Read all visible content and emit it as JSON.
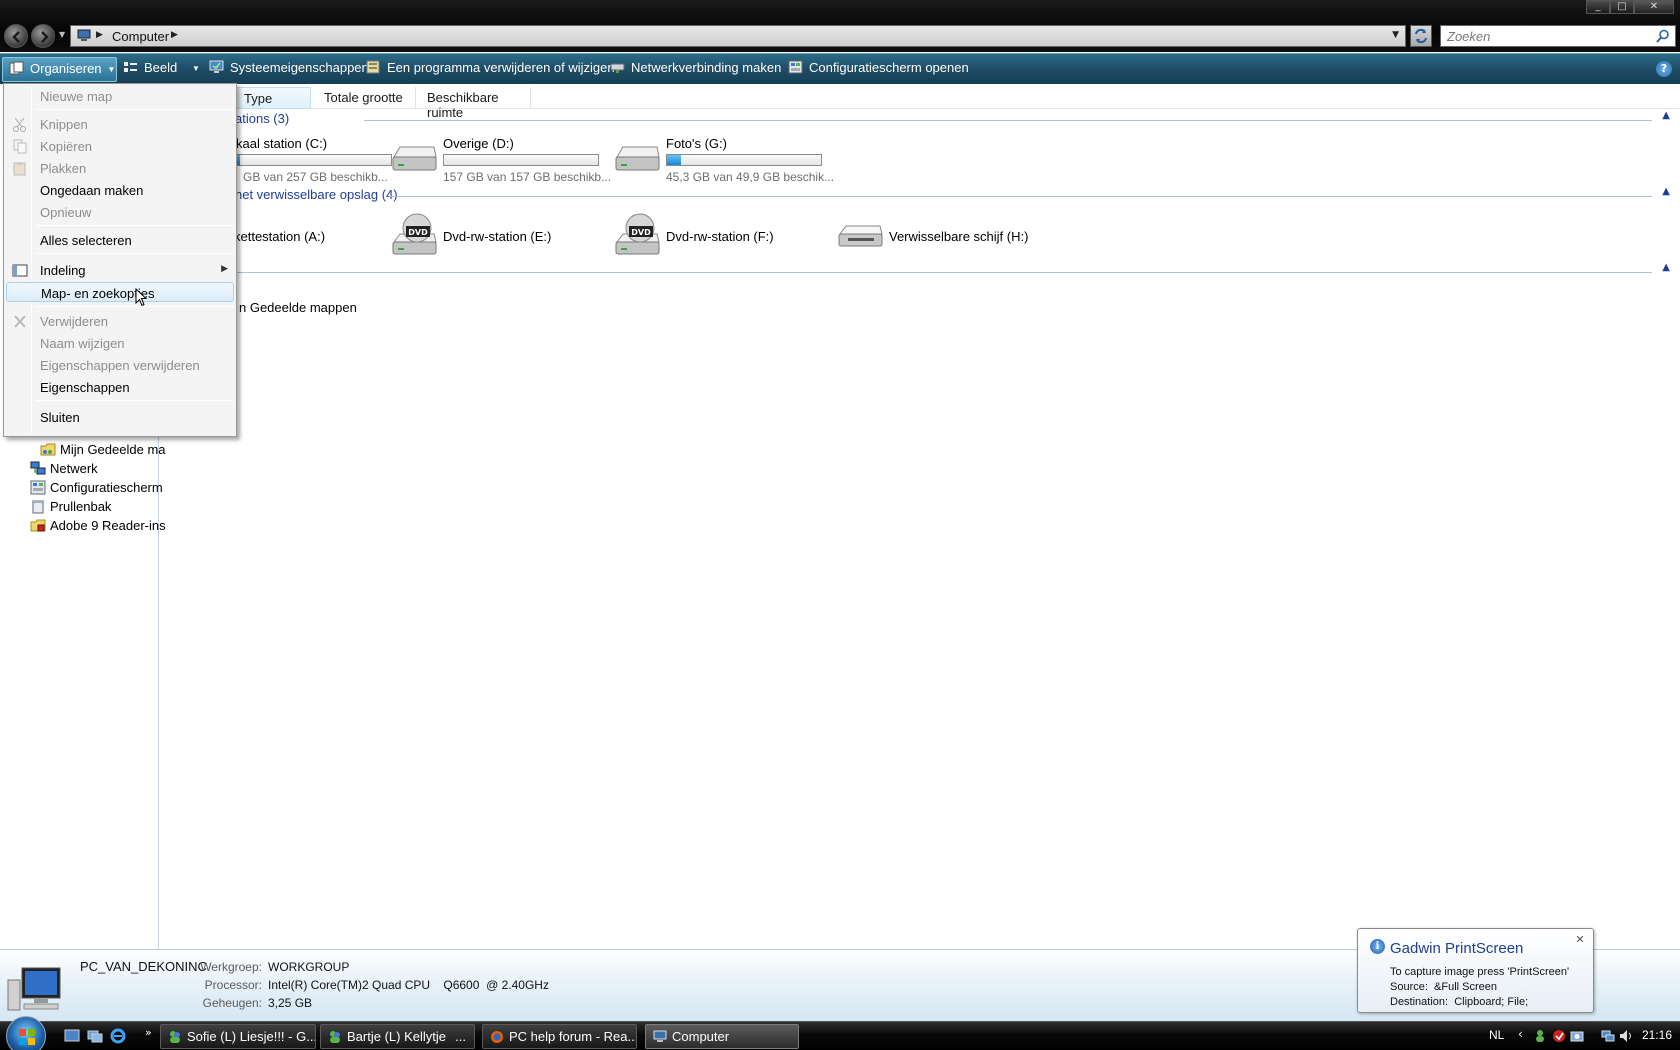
{
  "address": {
    "location": "Computer",
    "search_placeholder": "Zoeken"
  },
  "commandbar": {
    "organize": "Organiseren",
    "view": "Beeld",
    "system_properties": "Systeemeigenschappen",
    "uninstall": "Een programma verwijderen of wijzigen",
    "map_network": "Netwerkverbinding maken",
    "control_panel": "Configuratiescherm openen"
  },
  "columns": [
    "Type",
    "Totale grootte",
    "Beschikbare ruimte"
  ],
  "groups": {
    "hard_disks": "ations (3)",
    "removable": "net verwisselbare opslag (4)",
    "other_item": "n Gedeelde mappen"
  },
  "drives": [
    {
      "name": "kaal station (C:)",
      "free_text": "GB van 257 GB beschikb...",
      "used_fraction": 0.02
    },
    {
      "name": "Overige (D:)",
      "free_text": "157 GB van 157 GB beschikb...",
      "used_fraction": 0.0
    },
    {
      "name": "Foto's (G:)",
      "free_text": "45,3 GB van 49,9 GB beschik...",
      "used_fraction": 0.09
    }
  ],
  "removable_drives": [
    {
      "name": "kettestation (A:)",
      "icon": "floppy-icon"
    },
    {
      "name": "Dvd-rw-station (E:)",
      "icon": "dvd-drive-icon"
    },
    {
      "name": "Dvd-rw-station (F:)",
      "icon": "dvd-drive-icon"
    },
    {
      "name": "Verwisselbare schijf (H:)",
      "icon": "removable-disk-icon"
    }
  ],
  "nav_tree": [
    {
      "label": "Mijn Gedeelde ma",
      "icon": "shared-folder-icon"
    },
    {
      "label": "Netwerk",
      "icon": "network-icon"
    },
    {
      "label": "Configuratiescherm",
      "icon": "control-panel-icon"
    },
    {
      "label": "Prullenbak",
      "icon": "recycle-bin-icon"
    },
    {
      "label": "Adobe 9 Reader-ins",
      "icon": "installer-icon"
    }
  ],
  "menu": {
    "new_folder": "Nieuwe map",
    "cut": "Knippen",
    "copy": "Kopiëren",
    "paste": "Plakken",
    "undo": "Ongedaan maken",
    "redo": "Opnieuw",
    "select_all": "Alles selecteren",
    "layout": "Indeling",
    "folder_options": "Map- en zoekopties",
    "delete": "Verwijderen",
    "rename": "Naam wijzigen",
    "remove_properties": "Eigenschappen verwijderen",
    "properties": "Eigenschappen",
    "close": "Sluiten"
  },
  "details": {
    "computer_name": "PC_VAN_DEKONINC",
    "workgroup_label": "Werkgroep:",
    "workgroup": "WORKGROUP",
    "processor_label": "Processor:",
    "processor": "Intel(R) Core(TM)2 Quad CPU    Q6600  @ 2.40GHz",
    "memory_label": "Geheugen:",
    "memory": "3,25 GB"
  },
  "notification": {
    "title": "Gadwin PrintScreen",
    "line1": "To capture image press 'PrintScreen'",
    "line2": "Source:  &Full Screen",
    "line3": "Destination:  Clipboard; File;"
  },
  "taskbar": {
    "tasks": [
      "Sofie (L) Liesje!!! - G...",
      "Bartje (L) Kellytje",
      "...",
      "PC help forum - Rea...",
      "Computer"
    ],
    "language": "NL",
    "time": "21:16"
  },
  "colors": {
    "commandbar": "#1e4c66",
    "group_header": "#1e3d9a",
    "selection": "#dcecfa"
  }
}
